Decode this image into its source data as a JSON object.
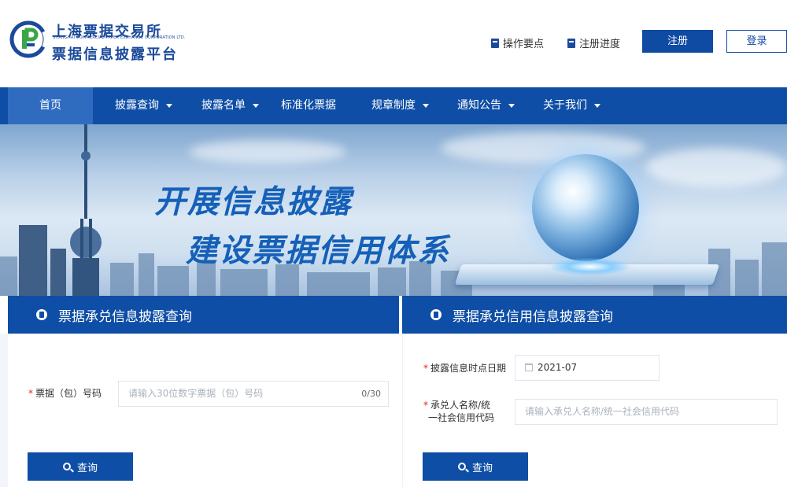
{
  "brand": {
    "name_cn": "上海票据交易所",
    "name_en": "SHANGHAI COMMERCIAL PAPER EXCHANGE CORPORATION LTD.",
    "subtitle": "票据信息披露平台",
    "logo_color": "#1b4a9a"
  },
  "header_links": {
    "guide": "操作要点",
    "progress": "注册进度",
    "register": "注册",
    "login": "登录"
  },
  "nav": {
    "items": [
      {
        "label": "首页",
        "active": true,
        "dropdown": false
      },
      {
        "label": "披露查询",
        "dropdown": true
      },
      {
        "label": "披露名单",
        "dropdown": true
      },
      {
        "label": "标准化票据",
        "dropdown": false
      },
      {
        "label": "规章制度",
        "dropdown": true
      },
      {
        "label": "通知公告",
        "dropdown": true
      },
      {
        "label": "关于我们",
        "dropdown": true
      }
    ]
  },
  "banner": {
    "line1": "开展信息披露",
    "line2": "建设票据信用体系"
  },
  "left_panel": {
    "title": "票据承兑信息披露查询",
    "field_label": "票据（包）号码",
    "field_placeholder": "请输入30位数字票据（包）号码",
    "char_count": "0/30",
    "button": "查询"
  },
  "right_panel": {
    "title": "票据承兑信用信息披露查询",
    "date_label": "披露信息时点日期",
    "date_value": "2021-07",
    "name_label_1": "承兑人名称/统",
    "name_label_2": "一社会信用代码",
    "name_placeholder": "请输入承兑人名称/统一社会信用代码",
    "button": "查询"
  },
  "colors": {
    "primary": "#0e4ea6",
    "nav_active": "#2f6cc0",
    "required": "#e2231a"
  }
}
